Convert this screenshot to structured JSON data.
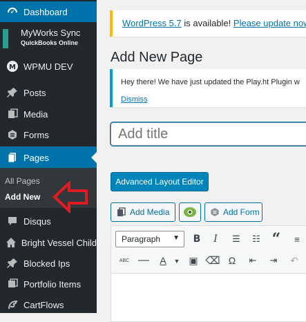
{
  "sidebar": {
    "dashboard": "Dashboard",
    "myworks_title": "MyWorks Sync",
    "myworks_sub": "QuickBooks Online",
    "wpmudev": "WPMU DEV",
    "posts": "Posts",
    "media": "Media",
    "forms": "Forms",
    "pages": "Pages",
    "sub_all_pages": "All Pages",
    "sub_add_new": "Add New",
    "disqus": "Disqus",
    "bright_vessel": "Bright Vessel Child",
    "blocked_ips": "Blocked Ips",
    "portfolio": "Portfolio Items",
    "cartflows": "CartFlows"
  },
  "notice": {
    "version_link": "WordPress 5.7",
    "middle": " is available! ",
    "update_link": "Please update now."
  },
  "main": {
    "title": "Add New Page",
    "info_text": "Hey there! We have just updated the Play.ht Plugin w",
    "dismiss": "Dismiss",
    "title_placeholder": "Add title",
    "ale_button": "Advanced Layout Editor",
    "add_media": "Add Media",
    "add_form": "Add Form"
  },
  "editor": {
    "format_select": "Paragraph"
  },
  "colors": {
    "sidebar_bg": "#23282d",
    "accent": "#0073aa",
    "notice_border": "#ffb900",
    "arrow": "#e11b22"
  }
}
